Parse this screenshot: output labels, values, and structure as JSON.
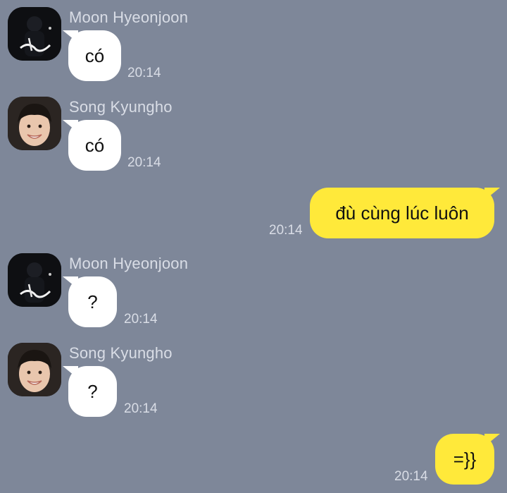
{
  "colors": {
    "background": "#7e8799",
    "incoming_bubble": "#ffffff",
    "outgoing_bubble": "#ffe93a",
    "meta_text": "#d9dde6"
  },
  "messages": [
    {
      "sender": "Moon Hyeonjoon",
      "avatar": "avatar-night-photo",
      "text": "có",
      "time": "20:14"
    },
    {
      "sender": "Song Kyungho",
      "avatar": "avatar-smiling-face",
      "text": "có",
      "time": "20:14"
    },
    {
      "sender": "",
      "text": "đù cùng lúc luôn",
      "time": "20:14"
    },
    {
      "sender": "Moon Hyeonjoon",
      "avatar": "avatar-night-photo",
      "text": "?",
      "time": "20:14"
    },
    {
      "sender": "Song Kyungho",
      "avatar": "avatar-smiling-face",
      "text": "?",
      "time": "20:14"
    },
    {
      "sender": "",
      "text": "=}}",
      "time": "20:14"
    }
  ]
}
